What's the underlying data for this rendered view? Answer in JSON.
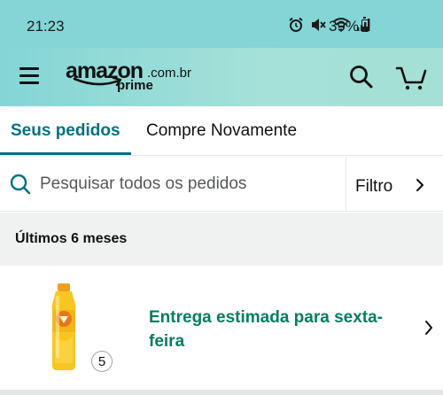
{
  "status_bar": {
    "time": "21:23",
    "battery_percent": "39%",
    "battery_level": 0.39
  },
  "header": {
    "logo": {
      "word": "amazon",
      "domain": ".com.br",
      "sub": "prime"
    },
    "icons": [
      "menu-icon",
      "search-icon",
      "cart-icon"
    ]
  },
  "tabs": [
    {
      "label": "Seus pedidos",
      "active": true
    },
    {
      "label": "Compre Novamente",
      "active": false
    }
  ],
  "search": {
    "placeholder": "Pesquisar todos os pedidos",
    "value": ""
  },
  "filter": {
    "label": "Filtro"
  },
  "section": {
    "title": "Últimos 6 meses"
  },
  "orders": [
    {
      "delivery_status": "Entrega estimada para sexta-feira",
      "quantity": "5"
    }
  ],
  "colors": {
    "header_bg": "#84d5d5",
    "accent_teal": "#007185",
    "delivery_green": "#067d62",
    "section_bg": "#f0f2f2"
  }
}
